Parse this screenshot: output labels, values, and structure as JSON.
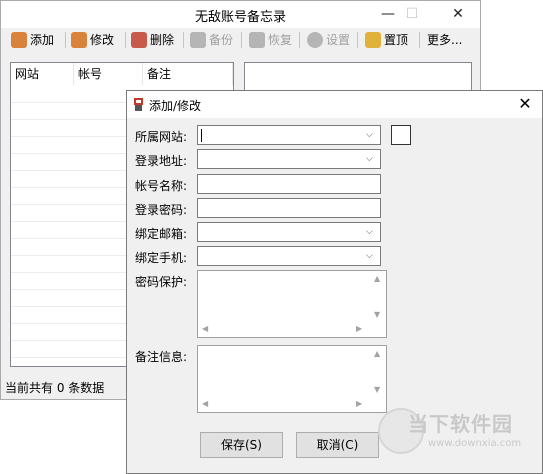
{
  "main": {
    "title": "无敌账号备忘录",
    "controls": {
      "minimize": "—",
      "maximize": "☐",
      "close": "✕"
    },
    "toolbar": [
      {
        "label": "添加",
        "enabled": true,
        "icon": "users-icon",
        "color": "#d9823b"
      },
      {
        "label": "修改",
        "enabled": true,
        "icon": "user-edit-icon",
        "color": "#d9823b"
      },
      {
        "label": "删除",
        "enabled": true,
        "icon": "user-delete-icon",
        "color": "#c75a4a"
      },
      {
        "label": "备份",
        "enabled": false,
        "icon": "backup-icon",
        "color": "#b5b5b5"
      },
      {
        "label": "恢复",
        "enabled": false,
        "icon": "restore-icon",
        "color": "#b5b5b5"
      },
      {
        "label": "设置",
        "enabled": false,
        "icon": "gear-icon",
        "color": "#b5b5b5"
      },
      {
        "label": "置顶",
        "enabled": true,
        "icon": "pin-icon",
        "color": "#e0b23a"
      },
      {
        "label": "更多...",
        "enabled": true,
        "icon": "",
        "color": ""
      }
    ],
    "list_headers": [
      "网站",
      "帐号",
      "备注"
    ],
    "status": "当前共有 0 条数据"
  },
  "dialog": {
    "title": "添加/修改",
    "close": "✕",
    "fields": [
      {
        "label": "所属网站:",
        "type": "combo",
        "value": ""
      },
      {
        "label": "登录地址:",
        "type": "combo",
        "value": ""
      },
      {
        "label": "帐号名称:",
        "type": "text",
        "value": ""
      },
      {
        "label": "登录密码:",
        "type": "text",
        "value": ""
      },
      {
        "label": "绑定邮箱:",
        "type": "combo",
        "value": ""
      },
      {
        "label": "绑定手机:",
        "type": "combo",
        "value": ""
      }
    ],
    "password_protect_label": "密码保护:",
    "notes_label": "备注信息:",
    "save_button": "保存(S)",
    "cancel_button": "取消(C)"
  },
  "watermark": {
    "name": "当下软件园",
    "url": "www.downxia.com"
  }
}
